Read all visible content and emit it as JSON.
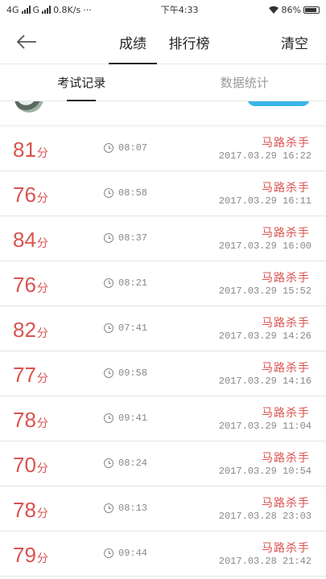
{
  "status_bar": {
    "network": "4G",
    "carrier": "G",
    "speed": "0.8K/s",
    "dots": "···",
    "time": "下午4:33",
    "battery": "86%"
  },
  "header": {
    "tabs": [
      {
        "label": "成绩",
        "active": true
      },
      {
        "label": "排行榜",
        "active": false
      }
    ],
    "clear_label": "清空"
  },
  "sub_tabs": [
    {
      "label": "考试记录",
      "active": true
    },
    {
      "label": "数据统计",
      "active": false
    }
  ],
  "records": [
    {
      "score": "81",
      "unit": "分",
      "duration": "08:07",
      "title": "马路杀手",
      "date": "2017.03.29  16:22"
    },
    {
      "score": "76",
      "unit": "分",
      "duration": "08:58",
      "title": "马路杀手",
      "date": "2017.03.29  16:11"
    },
    {
      "score": "84",
      "unit": "分",
      "duration": "08:37",
      "title": "马路杀手",
      "date": "2017.03.29  16:00"
    },
    {
      "score": "76",
      "unit": "分",
      "duration": "08:21",
      "title": "马路杀手",
      "date": "2017.03.29  15:52"
    },
    {
      "score": "82",
      "unit": "分",
      "duration": "07:41",
      "title": "马路杀手",
      "date": "2017.03.29  14:26"
    },
    {
      "score": "77",
      "unit": "分",
      "duration": "09:58",
      "title": "马路杀手",
      "date": "2017.03.29  14:16"
    },
    {
      "score": "78",
      "unit": "分",
      "duration": "09:41",
      "title": "马路杀手",
      "date": "2017.03.29  11:04"
    },
    {
      "score": "70",
      "unit": "分",
      "duration": "08:24",
      "title": "马路杀手",
      "date": "2017.03.29  10:54"
    },
    {
      "score": "78",
      "unit": "分",
      "duration": "08:13",
      "title": "马路杀手",
      "date": "2017.03.28  23:03"
    },
    {
      "score": "79",
      "unit": "分",
      "duration": "09:44",
      "title": "马路杀手",
      "date": "2017.03.28  21:42"
    }
  ]
}
